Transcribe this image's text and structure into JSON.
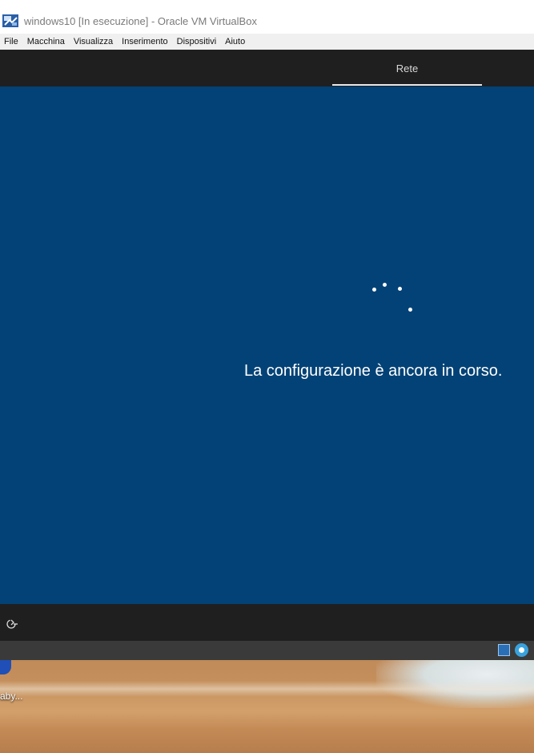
{
  "window": {
    "title": "windows10 [In esecuzione] - Oracle VM VirtualBox"
  },
  "menu": {
    "items": [
      "File",
      "Macchina",
      "Visualizza",
      "Inserimento",
      "Dispositivi",
      "Aiuto"
    ]
  },
  "vm": {
    "tab_label": "Rete",
    "status_message": "La configurazione è ancora in corso.",
    "background_color": "#034276"
  },
  "desktop": {
    "icon_label": "aby..."
  },
  "icons": {
    "app": "virtualbox-icon",
    "accessibility": "accessibility-icon",
    "status": [
      "shared-folder-icon",
      "optical-drive-icon"
    ]
  }
}
